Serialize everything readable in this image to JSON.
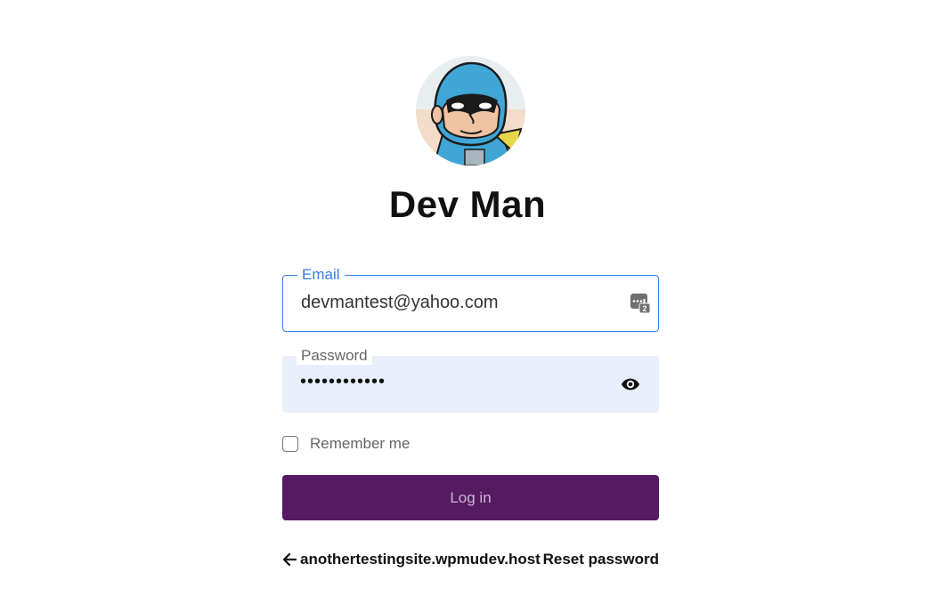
{
  "profile": {
    "name": "Dev Man",
    "avatar_icon": "superhero-avatar"
  },
  "email": {
    "label": "Email",
    "value": "devmantest@yahoo.com",
    "icon": "password-manager-key-icon"
  },
  "password": {
    "label": "Password",
    "value": "••••••••••••",
    "icon": "eye-icon"
  },
  "remember": {
    "label": "Remember me",
    "checked": false
  },
  "login_button": {
    "label": "Log in"
  },
  "footer": {
    "back_label": "anothertestingsite.wpmudev.host",
    "reset_label": "Reset password"
  },
  "colors": {
    "accent": "#3b7be0",
    "button": "#561a62",
    "password_fill": "#e8effb"
  }
}
